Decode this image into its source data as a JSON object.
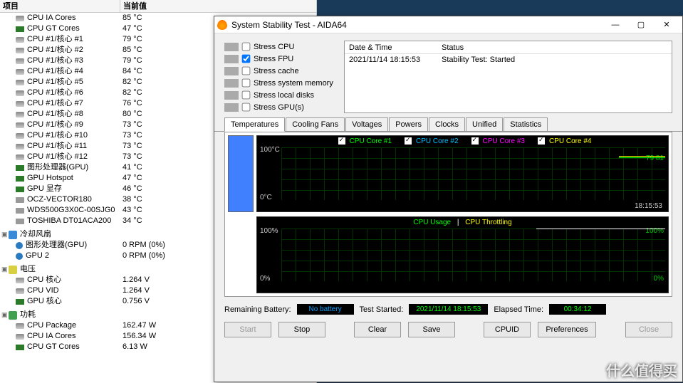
{
  "left": {
    "headers": {
      "item": "项目",
      "value": "当前值"
    },
    "temp_rows": [
      {
        "icon": "cpu",
        "name": "CPU IA Cores",
        "val": "85 °C",
        "dn": "cpu-ia-cores"
      },
      {
        "icon": "gpu",
        "name": "CPU GT Cores",
        "val": "47 °C",
        "dn": "cpu-gt-cores"
      },
      {
        "icon": "cpu",
        "name": "CPU #1/核心 #1",
        "val": "79 °C",
        "dn": "cpu-core-1"
      },
      {
        "icon": "cpu",
        "name": "CPU #1/核心 #2",
        "val": "85 °C",
        "dn": "cpu-core-2"
      },
      {
        "icon": "cpu",
        "name": "CPU #1/核心 #3",
        "val": "79 °C",
        "dn": "cpu-core-3"
      },
      {
        "icon": "cpu",
        "name": "CPU #1/核心 #4",
        "val": "84 °C",
        "dn": "cpu-core-4"
      },
      {
        "icon": "cpu",
        "name": "CPU #1/核心 #5",
        "val": "82 °C",
        "dn": "cpu-core-5"
      },
      {
        "icon": "cpu",
        "name": "CPU #1/核心 #6",
        "val": "82 °C",
        "dn": "cpu-core-6"
      },
      {
        "icon": "cpu",
        "name": "CPU #1/核心 #7",
        "val": "76 °C",
        "dn": "cpu-core-7"
      },
      {
        "icon": "cpu",
        "name": "CPU #1/核心 #8",
        "val": "80 °C",
        "dn": "cpu-core-8"
      },
      {
        "icon": "cpu",
        "name": "CPU #1/核心 #9",
        "val": "73 °C",
        "dn": "cpu-core-9"
      },
      {
        "icon": "cpu",
        "name": "CPU #1/核心 #10",
        "val": "73 °C",
        "dn": "cpu-core-10"
      },
      {
        "icon": "cpu",
        "name": "CPU #1/核心 #11",
        "val": "73 °C",
        "dn": "cpu-core-11"
      },
      {
        "icon": "cpu",
        "name": "CPU #1/核心 #12",
        "val": "73 °C",
        "dn": "cpu-core-12"
      },
      {
        "icon": "gpu",
        "name": "图形处理器(GPU)",
        "val": "41 °C",
        "dn": "gpu-temp"
      },
      {
        "icon": "gpu",
        "name": "GPU Hotspot",
        "val": "47 °C",
        "dn": "gpu-hotspot"
      },
      {
        "icon": "gpu",
        "name": "GPU 显存",
        "val": "46 °C",
        "dn": "gpu-mem"
      },
      {
        "icon": "disk",
        "name": "OCZ-VECTOR180",
        "val": "38 °C",
        "dn": "disk-ocz"
      },
      {
        "icon": "disk",
        "name": "WDS500G3X0C-00SJG0",
        "val": "43 °C",
        "dn": "disk-wd"
      },
      {
        "icon": "disk",
        "name": "TOSHIBA DT01ACA200",
        "val": "34 °C",
        "dn": "disk-toshiba"
      }
    ],
    "sections": {
      "fans": {
        "label": "冷却风扇",
        "rows": [
          {
            "icon": "fan",
            "name": "图形处理器(GPU)",
            "val": "0 RPM  (0%)",
            "dn": "fan-gpu"
          },
          {
            "icon": "fan",
            "name": "GPU 2",
            "val": "0 RPM  (0%)",
            "dn": "fan-gpu2"
          }
        ]
      },
      "voltages": {
        "label": "电压",
        "rows": [
          {
            "icon": "cpu",
            "name": "CPU 核心",
            "val": "1.264 V",
            "dn": "v-cpu-core"
          },
          {
            "icon": "cpu",
            "name": "CPU VID",
            "val": "1.264 V",
            "dn": "v-cpu-vid"
          },
          {
            "icon": "gpu",
            "name": "GPU 核心",
            "val": "0.756 V",
            "dn": "v-gpu-core"
          }
        ]
      },
      "power": {
        "label": "功耗",
        "rows": [
          {
            "icon": "cpu",
            "name": "CPU Package",
            "val": "162.47 W",
            "dn": "p-cpu-pkg"
          },
          {
            "icon": "cpu",
            "name": "CPU IA Cores",
            "val": "156.34 W",
            "dn": "p-cpu-ia"
          },
          {
            "icon": "gpu",
            "name": "CPU GT Cores",
            "val": "6.13 W",
            "dn": "p-cpu-gt"
          }
        ]
      }
    }
  },
  "dialog": {
    "title": "System Stability Test - AIDA64",
    "stress": [
      {
        "label": "Stress CPU",
        "checked": false,
        "dn": "stress-cpu"
      },
      {
        "label": "Stress FPU",
        "checked": true,
        "dn": "stress-fpu"
      },
      {
        "label": "Stress cache",
        "checked": false,
        "dn": "stress-cache"
      },
      {
        "label": "Stress system memory",
        "checked": false,
        "dn": "stress-memory"
      },
      {
        "label": "Stress local disks",
        "checked": false,
        "dn": "stress-disks"
      },
      {
        "label": "Stress GPU(s)",
        "checked": false,
        "dn": "stress-gpu"
      }
    ],
    "log": {
      "headers": {
        "datetime": "Date & Time",
        "status": "Status"
      },
      "rows": [
        {
          "datetime": "2021/11/14 18:15:53",
          "status": "Stability Test: Started"
        }
      ]
    },
    "tabs": [
      "Temperatures",
      "Cooling Fans",
      "Voltages",
      "Powers",
      "Clocks",
      "Unified",
      "Statistics"
    ],
    "active_tab": 0,
    "chart1": {
      "legend": [
        {
          "label": "CPU Core #1",
          "color": "#00ff00"
        },
        {
          "label": "CPU Core #2",
          "color": "#00bfff"
        },
        {
          "label": "CPU Core #3",
          "color": "#ff00ff"
        },
        {
          "label": "CPU Core #4",
          "color": "#ffff00"
        }
      ],
      "ytop": "100°C",
      "ybot": "0°C",
      "xtime": "18:15:53",
      "annot": "79  81"
    },
    "chart2": {
      "legend": [
        {
          "label": "CPU Usage",
          "color": "#00ff00"
        },
        {
          "label": "CPU Throttling",
          "color": "#ffff00"
        }
      ],
      "ytop": "100%",
      "ybot": "0%",
      "rtop": "100%",
      "rbot": "0%"
    },
    "status": {
      "battery_label": "Remaining Battery:",
      "battery_val": "No battery",
      "battery_color": "#00a0ff",
      "started_label": "Test Started:",
      "started_val": "2021/11/14 18:15:53",
      "started_color": "#00ff00",
      "elapsed_label": "Elapsed Time:",
      "elapsed_val": "00:34:12",
      "elapsed_color": "#00ff00"
    },
    "buttons": {
      "start": "Start",
      "stop": "Stop",
      "clear": "Clear",
      "save": "Save",
      "cpuid": "CPUID",
      "prefs": "Preferences",
      "close": "Close"
    }
  },
  "watermark": "什么值得买",
  "chart_data": {
    "type": "line",
    "title": "Temperatures",
    "ylim": [
      0,
      100
    ],
    "series": [
      {
        "name": "CPU Core #1",
        "values": [
          79
        ]
      },
      {
        "name": "CPU Core #2",
        "values": [
          85
        ]
      },
      {
        "name": "CPU Core #3",
        "values": [
          79
        ]
      },
      {
        "name": "CPU Core #4",
        "values": [
          84
        ]
      }
    ],
    "x": [
      "18:15:53"
    ]
  }
}
